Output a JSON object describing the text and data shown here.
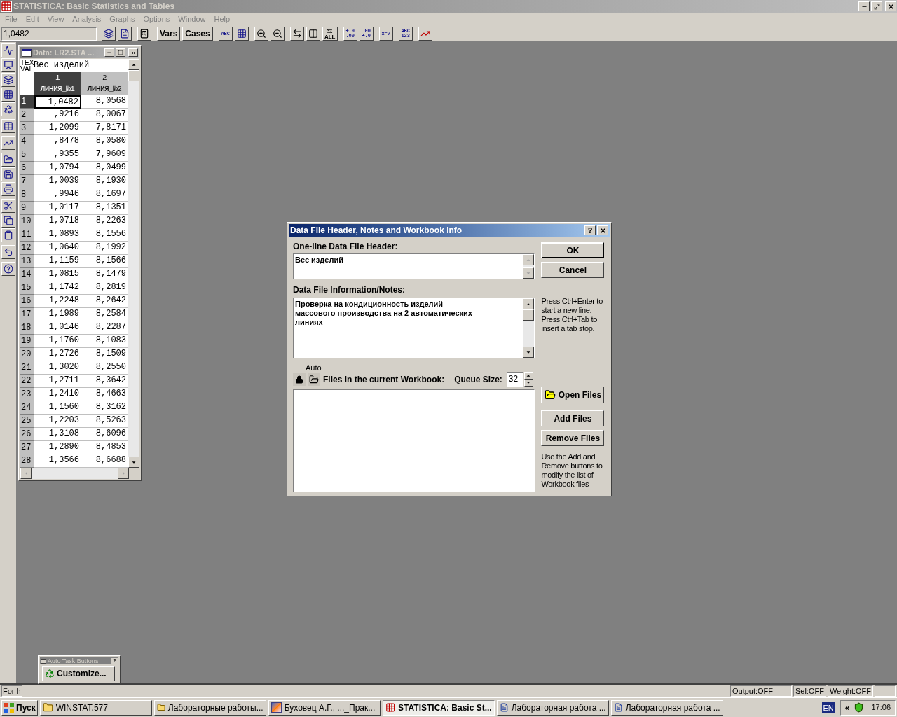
{
  "window": {
    "title": "STATISTICA: Basic Statistics and Tables"
  },
  "menu": [
    "File",
    "Edit",
    "View",
    "Analysis",
    "Graphs",
    "Options",
    "Window",
    "Help"
  ],
  "toolbar": {
    "value": "1,0482",
    "text_buttons": [
      "Vars",
      "Cases"
    ],
    "fit_label": "ALL",
    "glyphs": [
      [
        "ABC"
      ],
      [
        "+.0",
        ".00"
      ],
      [
        ".00",
        "+.0"
      ],
      [
        "x=?"
      ],
      [
        "ABC",
        "123"
      ]
    ]
  },
  "data_window": {
    "title": "Data: LR2.STA ...",
    "side_labels": [
      "TEX",
      "VAL"
    ],
    "header": "Вес изделий",
    "columns": [
      {
        "number": "1",
        "name": "ЛИНИЯ_№1",
        "selected": true
      },
      {
        "number": "2",
        "name": "ЛИНИЯ_№2",
        "selected": false
      }
    ],
    "rows": [
      {
        "number": "1",
        "selected": true,
        "cells": [
          "1,0482",
          "8,0568"
        ]
      },
      {
        "number": "2",
        "selected": false,
        "cells": [
          ",9216",
          "8,0067"
        ]
      },
      {
        "number": "3",
        "selected": false,
        "cells": [
          "1,2099",
          "7,8171"
        ]
      },
      {
        "number": "4",
        "selected": false,
        "cells": [
          ",8478",
          "8,0580"
        ]
      },
      {
        "number": "5",
        "selected": false,
        "cells": [
          ",9355",
          "7,9609"
        ]
      },
      {
        "number": "6",
        "selected": false,
        "cells": [
          "1,0794",
          "8,0499"
        ]
      },
      {
        "number": "7",
        "selected": false,
        "cells": [
          "1,0039",
          "8,1930"
        ]
      },
      {
        "number": "8",
        "selected": false,
        "cells": [
          ",9946",
          "8,1697"
        ]
      },
      {
        "number": "9",
        "selected": false,
        "cells": [
          "1,0117",
          "8,1351"
        ]
      },
      {
        "number": "10",
        "selected": false,
        "cells": [
          "1,0718",
          "8,2263"
        ]
      },
      {
        "number": "11",
        "selected": false,
        "cells": [
          "1,0893",
          "8,1556"
        ]
      },
      {
        "number": "12",
        "selected": false,
        "cells": [
          "1,0640",
          "8,1992"
        ]
      },
      {
        "number": "13",
        "selected": false,
        "cells": [
          "1,1159",
          "8,1566"
        ]
      },
      {
        "number": "14",
        "selected": false,
        "cells": [
          "1,0815",
          "8,1479"
        ]
      },
      {
        "number": "15",
        "selected": false,
        "cells": [
          "1,1742",
          "8,2819"
        ]
      },
      {
        "number": "16",
        "selected": false,
        "cells": [
          "1,2248",
          "8,2642"
        ]
      },
      {
        "number": "17",
        "selected": false,
        "cells": [
          "1,1989",
          "8,2584"
        ]
      },
      {
        "number": "18",
        "selected": false,
        "cells": [
          "1,0146",
          "8,2287"
        ]
      },
      {
        "number": "19",
        "selected": false,
        "cells": [
          "1,1760",
          "8,1083"
        ]
      },
      {
        "number": "20",
        "selected": false,
        "cells": [
          "1,2726",
          "8,1509"
        ]
      },
      {
        "number": "21",
        "selected": false,
        "cells": [
          "1,3020",
          "8,2550"
        ]
      },
      {
        "number": "22",
        "selected": false,
        "cells": [
          "1,2711",
          "8,3642"
        ]
      },
      {
        "number": "23",
        "selected": false,
        "cells": [
          "1,2410",
          "8,4663"
        ]
      },
      {
        "number": "24",
        "selected": false,
        "cells": [
          "1,1560",
          "8,3162"
        ]
      },
      {
        "number": "25",
        "selected": false,
        "cells": [
          "1,2203",
          "8,5263"
        ]
      },
      {
        "number": "26",
        "selected": false,
        "cells": [
          "1,3108",
          "8,6096"
        ]
      },
      {
        "number": "27",
        "selected": false,
        "cells": [
          "1,2890",
          "8,4853"
        ]
      },
      {
        "number": "28",
        "selected": false,
        "cells": [
          "1,3566",
          "8,6688"
        ]
      }
    ]
  },
  "dialog": {
    "title": "Data File Header, Notes and Workbook Info",
    "help": "?",
    "header_label": "One-line Data File Header:",
    "header_value": "Вес изделий",
    "notes_label": "Data File Information/Notes:",
    "notes_value": "Проверка на кондиционность изделий массового производства на 2 автоматических линиях",
    "hint": "Press Ctrl+Enter to start a new line. Press Ctrl+Tab to insert a tab stop.",
    "auto_label": "Auto",
    "files_label": "Files in the current Workbook:",
    "queue_label": "Queue Size:",
    "queue_value": "32",
    "ok": "OK",
    "cancel": "Cancel",
    "open_files": "Open Files",
    "add_files": "Add Files",
    "remove_files": "Remove Files",
    "note": "Use the Add and Remove buttons to modify the list of Workbook files"
  },
  "auto_task_buttons": {
    "title": "Auto Task Buttons",
    "help": "?",
    "button": "Customize..."
  },
  "status_bar": {
    "message": "For h",
    "panels": [
      "Output:OFF",
      "Sel:OFF",
      "Weight:OFF"
    ]
  },
  "taskbar": {
    "start": "Пуск",
    "tasks": [
      {
        "kind": "folder",
        "label": "WINSTAT.577",
        "selected": false
      },
      {
        "kind": "folder",
        "label": "Лабораторные работы...",
        "selected": false
      },
      {
        "kind": "reader",
        "label": "Буховец А.Г., ..._Прак...",
        "selected": false
      },
      {
        "kind": "app",
        "label": "STATISTICA: Basic St...",
        "selected": true
      },
      {
        "kind": "word",
        "label": "Лабораторная работа ...",
        "selected": false
      },
      {
        "kind": "word",
        "label": "Лабораторная работа ...",
        "selected": false
      }
    ],
    "language": "EN",
    "expand": "«",
    "time": "17:06"
  }
}
